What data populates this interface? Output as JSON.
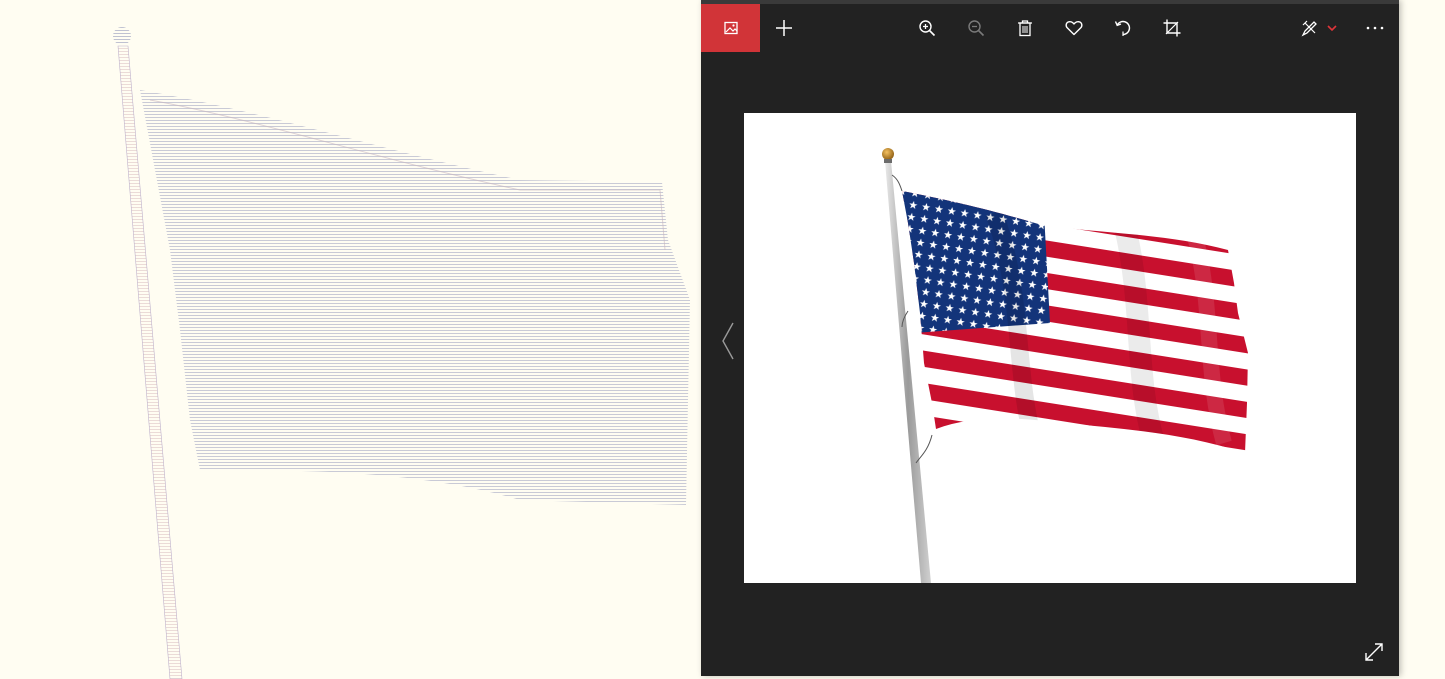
{
  "toolbar": {
    "items": [
      {
        "name": "photos-app-button",
        "icon": "photos-app-icon"
      },
      {
        "name": "add-to-button",
        "icon": "plus-icon"
      },
      {
        "name": "zoom-in-button",
        "icon": "zoom-in-icon"
      },
      {
        "name": "zoom-out-button",
        "icon": "zoom-out-icon",
        "disabled": true
      },
      {
        "name": "delete-button",
        "icon": "trash-icon"
      },
      {
        "name": "favorite-button",
        "icon": "heart-icon"
      },
      {
        "name": "rotate-button",
        "icon": "rotate-icon"
      },
      {
        "name": "crop-button",
        "icon": "crop-icon"
      },
      {
        "name": "edit-draw-button",
        "icon": "edit-pen-icon"
      },
      {
        "name": "more-options-button",
        "icon": "more-icon"
      }
    ]
  },
  "viewer": {
    "image_subject": "flag-of-the-united-states-on-pole",
    "navigation": {
      "prev_icon": "chevron-left-icon"
    },
    "fullscreen_icon": "expand-icon"
  },
  "colors": {
    "viewer_bg": "#222222",
    "accent": "#d13438",
    "flag_red": "#c8102e",
    "flag_blue": "#13347a",
    "left_bg": "#fffdf2"
  }
}
